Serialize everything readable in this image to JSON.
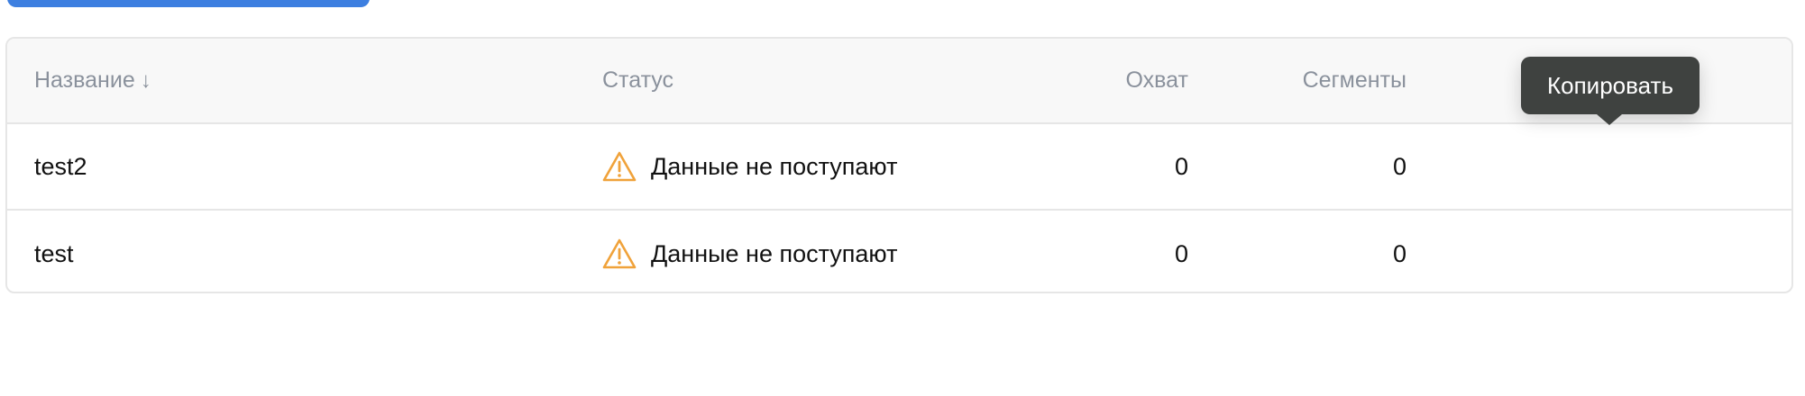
{
  "top_action": {
    "color": "#3d7fe0"
  },
  "table": {
    "headers": {
      "name": "Название",
      "status": "Статус",
      "reach": "Охват",
      "segments": "Сегменты"
    },
    "sort_icon": "arrow-down-icon",
    "rows": [
      {
        "name": "test2",
        "status_icon": "warning-icon",
        "status": "Данные не поступают",
        "reach": "0",
        "segments": "0"
      },
      {
        "name": "test",
        "status_icon": "warning-icon",
        "status": "Данные не поступают",
        "reach": "0",
        "segments": "0"
      }
    ]
  },
  "tooltip": {
    "text": "Копировать"
  },
  "colors": {
    "warning": "#f0a23a",
    "header_text": "#8a919c",
    "tooltip_bg": "#3f4240"
  }
}
